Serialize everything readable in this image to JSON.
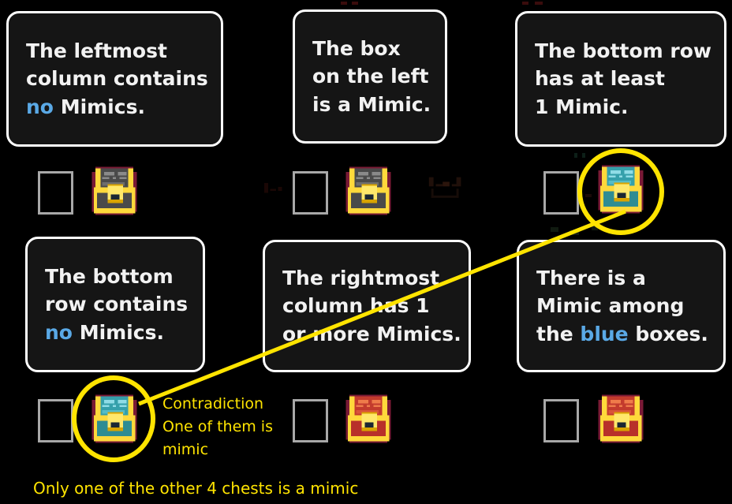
{
  "background_color": "#000000",
  "accent_annotation_color": "#ffe400",
  "clue_text_color": "#f2f2f2",
  "highlight_color": "#5aa9e6",
  "clues": [
    {
      "id": "clue-leftmost-column-no-mimics",
      "lines": [
        {
          "pre": "The leftmost",
          "hl": "",
          "post": ""
        },
        {
          "pre": "column contains",
          "hl": "",
          "post": ""
        },
        {
          "pre": "",
          "hl": "no",
          "post": " Mimics."
        }
      ]
    },
    {
      "id": "clue-box-on-left-is-mimic",
      "lines": [
        {
          "pre": "The box",
          "hl": "",
          "post": ""
        },
        {
          "pre": "on the left",
          "hl": "",
          "post": ""
        },
        {
          "pre": "is a Mimic.",
          "hl": "",
          "post": ""
        }
      ]
    },
    {
      "id": "clue-bottom-row-at-least-1-mimic",
      "lines": [
        {
          "pre": "The bottom row",
          "hl": "",
          "post": ""
        },
        {
          "pre": "has at least",
          "hl": "",
          "post": ""
        },
        {
          "pre": "1 Mimic.",
          "hl": "",
          "post": ""
        }
      ]
    },
    {
      "id": "clue-bottom-row-no-mimics",
      "lines": [
        {
          "pre": "The bottom",
          "hl": "",
          "post": ""
        },
        {
          "pre": "row contains",
          "hl": "",
          "post": ""
        },
        {
          "pre": "",
          "hl": "no",
          "post": " Mimics."
        }
      ]
    },
    {
      "id": "clue-rightmost-column-1-or-more",
      "lines": [
        {
          "pre": "The rightmost",
          "hl": "",
          "post": ""
        },
        {
          "pre": "column has 1",
          "hl": "",
          "post": ""
        },
        {
          "pre": "or more Mimics.",
          "hl": "",
          "post": ""
        }
      ]
    },
    {
      "id": "clue-mimic-among-blue-boxes",
      "lines": [
        {
          "pre": "There is a",
          "hl": "",
          "post": ""
        },
        {
          "pre": "Mimic among",
          "hl": "",
          "post": ""
        },
        {
          "pre": "the ",
          "hl": "blue",
          "post": " boxes."
        }
      ]
    }
  ],
  "chests": [
    {
      "id": "chest-row1-col1",
      "color": "gray",
      "circled": false
    },
    {
      "id": "chest-row1-col2",
      "color": "gray",
      "circled": false
    },
    {
      "id": "chest-row1-col3",
      "color": "blue",
      "circled": true
    },
    {
      "id": "chest-row2-col1",
      "color": "blue",
      "circled": true
    },
    {
      "id": "chest-row2-col2",
      "color": "red",
      "circled": false
    },
    {
      "id": "chest-row2-col3",
      "color": "red",
      "circled": false
    }
  ],
  "annotations": {
    "contradiction": {
      "lines": [
        "Contradiction",
        "One of them is",
        "mimic"
      ]
    },
    "bottom_note": "Only one of the other 4 chests is a mimic"
  },
  "icons": {
    "chest": "treasure-chest-icon",
    "empty_box": "empty-box-icon",
    "circle": "highlight-circle-icon",
    "connector": "connector-line-icon"
  }
}
